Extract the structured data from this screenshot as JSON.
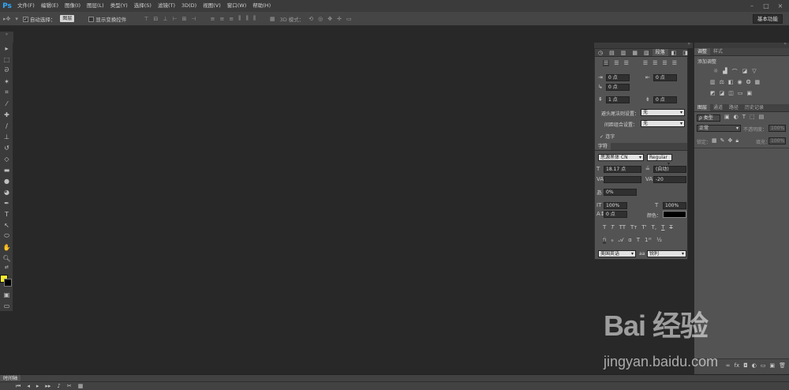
{
  "app": {
    "logo": "Ps"
  },
  "menubar": {
    "items": [
      "文件(F)",
      "编辑(E)",
      "图像(I)",
      "图层(L)",
      "类型(Y)",
      "选择(S)",
      "滤镜(T)",
      "3D(D)",
      "视图(V)",
      "窗口(W)",
      "帮助(H)"
    ],
    "window_buttons": [
      "–",
      "□",
      "×"
    ]
  },
  "options": {
    "auto_select_label": "自动选择：",
    "auto_select_value": "图层",
    "show_transform_label": "显示变换控件",
    "mode_3d_label": "3D 模式：",
    "workspace_label": "基本功能"
  },
  "paragraph": {
    "tabs": [
      "段落"
    ],
    "indent_left": "0 点",
    "indent_right": "0 点",
    "indent_first": "0 点",
    "space_before": "1 点",
    "space_after": "0 点",
    "kinsoku_label": "避头尾法则设置：",
    "kinsoku_value": "无",
    "mojikumi_label": "间距组合设置：",
    "mojikumi_value": "无",
    "hyphenate_label": "连字"
  },
  "character": {
    "tab": "字符",
    "font_family": "思源黑体 CN",
    "font_style": "Regular",
    "font_size": "18.17 点",
    "leading": "(自动)",
    "kerning": "",
    "tracking": "-20",
    "vscale_pct": "0%",
    "vertical_scale": "100%",
    "horizontal_scale": "100%",
    "baseline_shift": "0 点",
    "color_label": "颜色：",
    "color_value": "#000000",
    "style_buttons": [
      "T",
      "T",
      "TT",
      "Tт",
      "T'",
      "T,",
      "T",
      "T"
    ],
    "language": "美国英语",
    "aa_label": "aa",
    "antialias": "锐利"
  },
  "adjustments": {
    "tabs": [
      "调整",
      "样式"
    ],
    "title": "添加调整"
  },
  "layers": {
    "tabs": [
      "图层",
      "通道",
      "路径",
      "历史记录"
    ],
    "filter_label": "ρ 类型",
    "blend_mode": "正常",
    "opacity_label": "不透明度：",
    "opacity_value": "100%",
    "lock_label": "锁定：",
    "fill_label": "填充：",
    "fill_value": "100%"
  },
  "timeline": {
    "tab": "时间轴"
  },
  "watermark": {
    "main": "Bai 经验",
    "sub": "jingyan.baidu.com"
  }
}
